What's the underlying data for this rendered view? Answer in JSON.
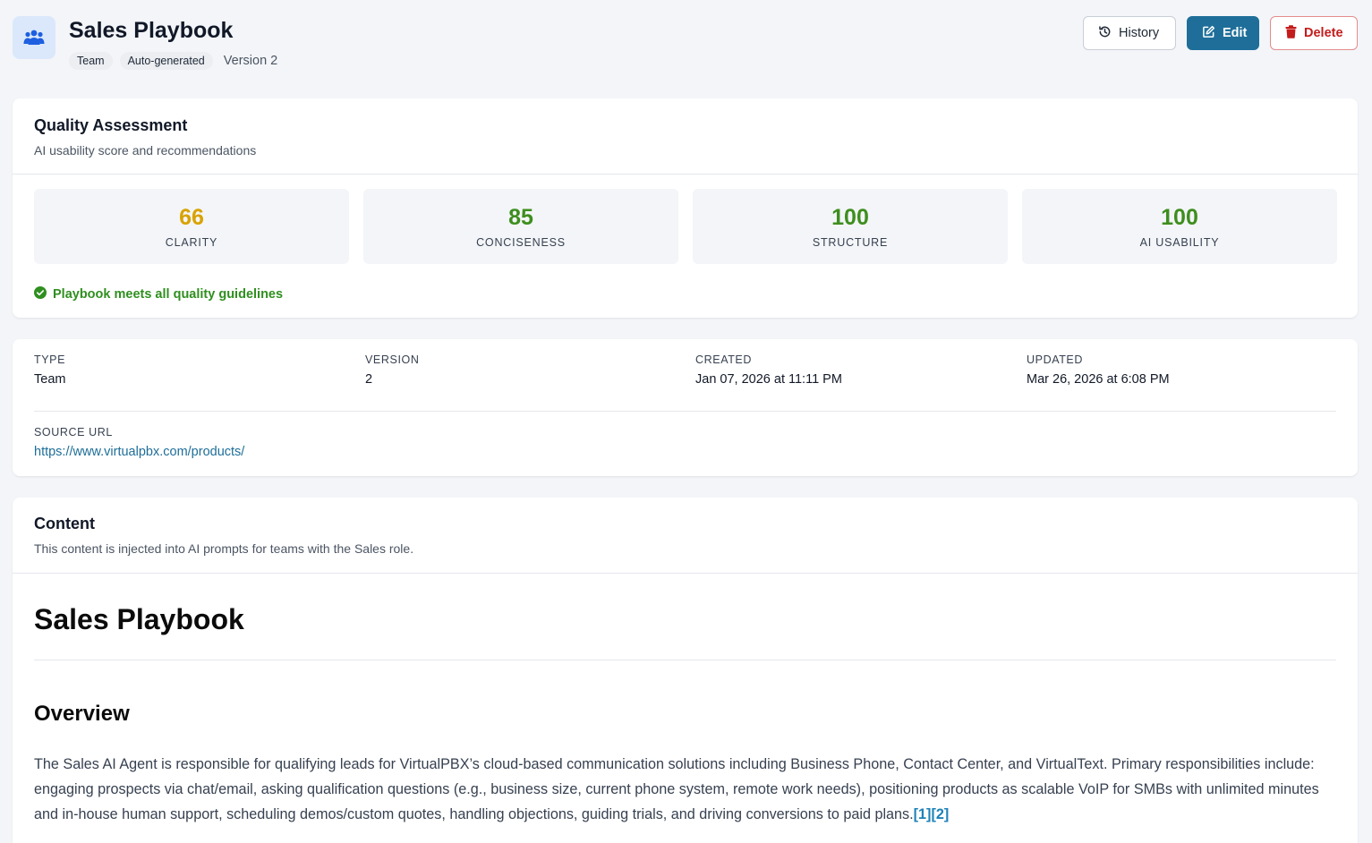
{
  "header": {
    "title": "Sales Playbook",
    "tags": [
      "Team",
      "Auto-generated"
    ],
    "version_text": "Version 2",
    "icon": "team-icon",
    "actions": {
      "history_label": "History",
      "edit_label": "Edit",
      "delete_label": "Delete"
    }
  },
  "quality": {
    "title": "Quality Assessment",
    "subtitle": "AI usability score and recommendations",
    "scores": [
      {
        "value": "66",
        "label": "CLARITY",
        "color": "#d9a200"
      },
      {
        "value": "85",
        "label": "CONCISENESS",
        "color": "#3e8e1e"
      },
      {
        "value": "100",
        "label": "STRUCTURE",
        "color": "#3e8e1e"
      },
      {
        "value": "100",
        "label": "AI USABILITY",
        "color": "#3e8e1e"
      }
    ],
    "status": "Playbook meets all quality guidelines"
  },
  "meta": {
    "type_label": "TYPE",
    "type_value": "Team",
    "version_label": "VERSION",
    "version_value": "2",
    "created_label": "CREATED",
    "created_value": "Jan 07, 2026 at 11:11 PM",
    "updated_label": "UPDATED",
    "updated_value": "Mar 26, 2026 at 6:08 PM",
    "source_label": "SOURCE URL",
    "source_value": "https://www.virtualpbx.com/products/"
  },
  "content": {
    "title": "Content",
    "subtitle": "This content is injected into AI prompts for teams with the Sales role.",
    "doc_title": "Sales Playbook",
    "section_title": "Overview",
    "paragraph": "The Sales AI Agent is responsible for qualifying leads for VirtualPBX’s cloud-based communication solutions including Business Phone, Contact Center, and VirtualText. Primary responsibilities include: engaging prospects via chat/email, asking qualification questions (e.g., business size, current phone system, remote work needs), positioning products as scalable VoIP for SMBs with unlimited minutes and in-house human support, scheduling demos/custom quotes, handling objections, guiding trials, and driving conversions to paid plans.",
    "citations": [
      "[1]",
      "[2]"
    ]
  },
  "colors": {
    "accent": "#1e6e99",
    "danger": "#c41b1b",
    "success": "#2f8f1f",
    "warning": "#d9a200"
  }
}
